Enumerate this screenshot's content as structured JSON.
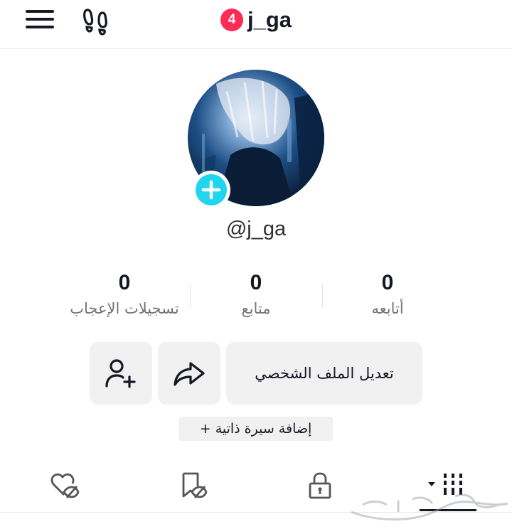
{
  "header": {
    "notification_count": "4",
    "title": "j_ga"
  },
  "profile": {
    "handle": "@j_ga"
  },
  "stats": {
    "following": {
      "value": "0",
      "label": "أتابعه"
    },
    "followers": {
      "value": "0",
      "label": "متابع"
    },
    "likes": {
      "value": "0",
      "label": "تسجيلات الإعجاب"
    }
  },
  "actions": {
    "edit_profile": "تعديل الملف الشخصي",
    "add_bio": "+ إضافة سيرة ذاتية"
  },
  "tabs": [
    {
      "icon": "grid-icon",
      "active": true
    },
    {
      "icon": "lock-icon",
      "active": false
    },
    {
      "icon": "bookmark-hidden-icon",
      "active": false
    },
    {
      "icon": "heart-hidden-icon",
      "active": false
    }
  ],
  "colors": {
    "accent": "#fe2c55",
    "avatar_add": "#20d5ec",
    "button_bg": "#f1f1f2",
    "text": "#161823",
    "secondary_text": "#737373"
  }
}
